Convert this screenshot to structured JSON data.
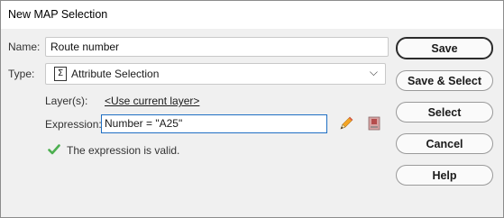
{
  "window": {
    "title": "New MAP Selection"
  },
  "form": {
    "name_label": "Name:",
    "name_value": "Route number",
    "type_label": "Type:",
    "type_value": "Attribute Selection",
    "layers_label": "Layer(s):",
    "layers_link": "<Use current layer>",
    "expression_label": "Expression:",
    "expression_value": "Number = \"A25\"",
    "validation_message": "The expression is valid."
  },
  "buttons": {
    "save": "Save",
    "save_select": "Save & Select",
    "select": "Select",
    "cancel": "Cancel",
    "help": "Help"
  },
  "icons": {
    "type_icon": "sigma-icon",
    "dropdown": "chevron-down-icon",
    "edit": "pencil-icon",
    "table": "database-table-icon",
    "valid": "checkmark-icon"
  },
  "colors": {
    "focus_border": "#1f6fc3",
    "valid_check": "#4caf50"
  }
}
